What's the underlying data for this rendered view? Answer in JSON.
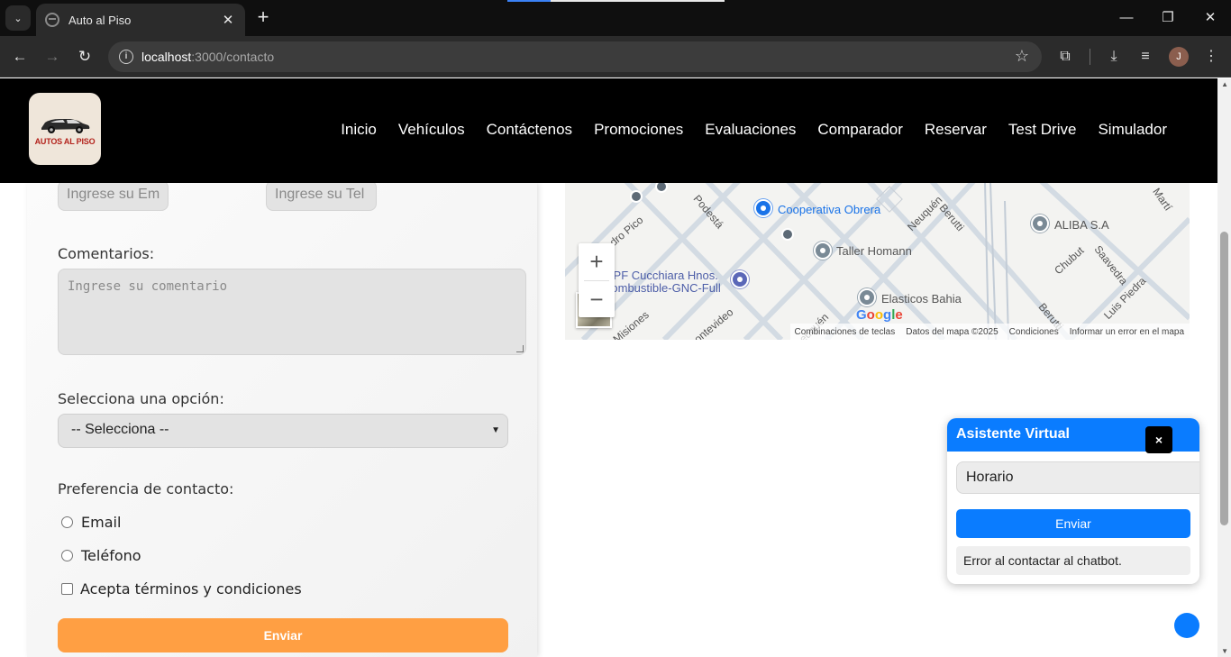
{
  "browser": {
    "tab_title": "Auto al Piso",
    "url_host": "localhost",
    "url_path": ":3000/contacto",
    "profile_initial": "J"
  },
  "site": {
    "logo_text": "AUTOS AL PISO",
    "nav": [
      "Inicio",
      "Vehículos",
      "Contáctenos",
      "Promociones",
      "Evaluaciones",
      "Comparador",
      "Reservar",
      "Test Drive",
      "Simulador"
    ]
  },
  "form": {
    "email_placeholder": "Ingrese su Em",
    "phone_placeholder": "Ingrese su Tel",
    "comments_label": "Comentarios:",
    "comments_placeholder": "Ingrese su comentario",
    "option_label": "Selecciona una opción:",
    "option_selected": "-- Selecciona --",
    "contact_pref_label": "Preferencia de contacto:",
    "radio_email": "Email",
    "radio_phone": "Teléfono",
    "terms_label": "Acepta términos y condiciones",
    "submit_label": "Enviar",
    "accent_color": "#ff9f43"
  },
  "map": {
    "places": {
      "cooperativa": "Cooperativa Obrera",
      "taller": "Taller Homann",
      "aliba": "ALIBA S.A",
      "elasticos": "Elasticos Bahia",
      "ypf_line1": "YPF Cucchiara Hnos.",
      "ypf_line2": "Combustible-GNC-Full"
    },
    "streets": {
      "pedro_pico": "Pedro Pico",
      "podesta": "Podestá",
      "neuquen": "Neuquén",
      "berutti": "Berutti",
      "chubut": "Chubut",
      "saavedra": "Saavedra",
      "luis_piedra": "Luis Piedra",
      "berutti2": "Berutti",
      "montevideo": "ontevideo",
      "misiones": "Misiones",
      "neuquen2": "euquén",
      "martin": "Martí"
    },
    "footer": [
      "Combinaciones de teclas",
      "Datos del mapa ©2025",
      "Condiciones",
      "Informar un error en el mapa"
    ],
    "google": "Google"
  },
  "chatbot": {
    "title": "Asistente Virtual",
    "close": "×",
    "input_value": "Horario",
    "send_label": "Enviar",
    "message": "Error al contactar al chatbot.",
    "accent_color": "#0a7cff"
  }
}
